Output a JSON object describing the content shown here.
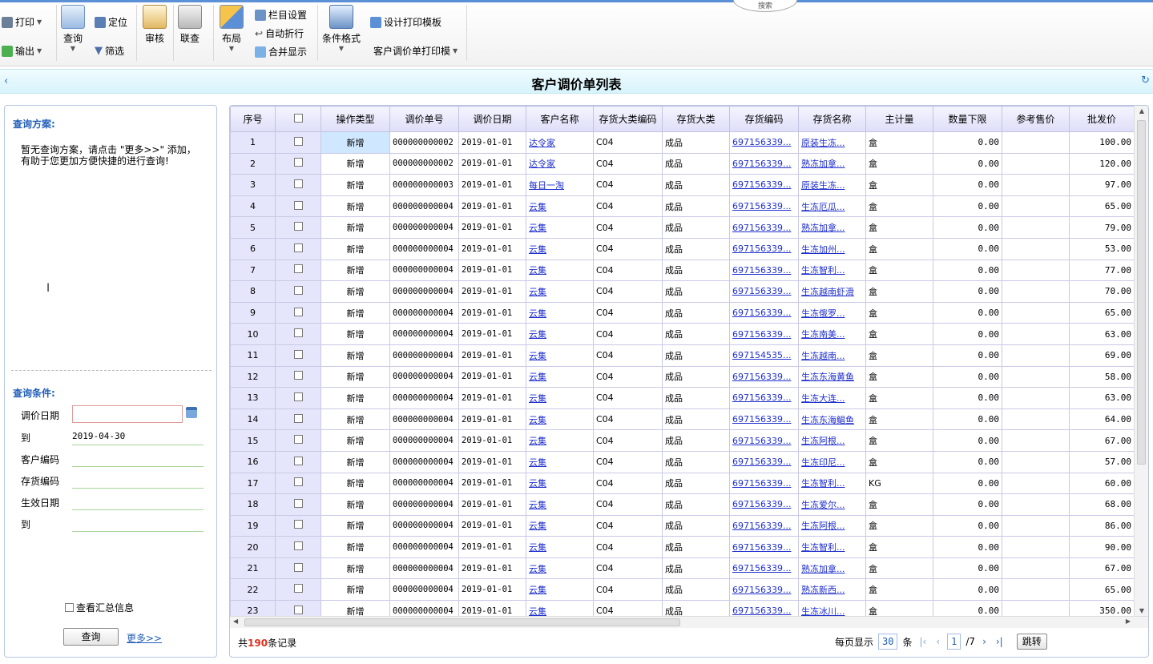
{
  "toolbar": {
    "print": "打印",
    "export": "输出",
    "query": "查询",
    "locate": "定位",
    "filter": "筛选",
    "audit": "审核",
    "linked_query": "联查",
    "layout": "布局",
    "column_settings": "栏目设置",
    "auto_wrap": "自动折行",
    "merge_display": "合并显示",
    "conditional_format": "条件格式",
    "design_print_template": "设计打印模板",
    "print_template_select": "客户调价单打印模",
    "tab_text": "搜索"
  },
  "titlebar": {
    "title": "客户调价单列表",
    "back_icon": "‹",
    "refresh_icon": "↻"
  },
  "left_panel": {
    "scheme_heading": "查询方案:",
    "no_scheme_text": "暂无查询方案，请点击 \"更多>>\" 添加，有助于您更加方便快捷的进行查询!",
    "conditions_heading": "查询条件:",
    "conditions": [
      {
        "label": "调价日期",
        "value": ""
      },
      {
        "label": "到",
        "value": "2019-04-30"
      },
      {
        "label": "客户编码",
        "value": ""
      },
      {
        "label": "存货编码",
        "value": ""
      },
      {
        "label": "生效日期",
        "value": ""
      },
      {
        "label": "到",
        "value": ""
      }
    ],
    "summary_label": "查看汇总信息",
    "query_button": "查询",
    "more_link": "更多>>"
  },
  "grid": {
    "headers": [
      "序号",
      "",
      "操作类型",
      "调价单号",
      "调价日期",
      "客户名称",
      "存货大类编码",
      "存货大类",
      "存货编码",
      "存货名称",
      "主计量",
      "数量下限",
      "参考售价",
      "批发价"
    ],
    "rows": [
      [
        "1",
        "新增",
        "000000000002",
        "2019-01-01",
        "达令家",
        "C04",
        "成品",
        "697156339...",
        "原装生冻...",
        "盒",
        "0.00",
        "",
        "100.00"
      ],
      [
        "2",
        "新增",
        "000000000002",
        "2019-01-01",
        "达令家",
        "C04",
        "成品",
        "697156339...",
        "熟冻加拿...",
        "盒",
        "0.00",
        "",
        "120.00"
      ],
      [
        "3",
        "新增",
        "000000000003",
        "2019-01-01",
        "每日一淘",
        "C04",
        "成品",
        "697156339...",
        "原装生冻...",
        "盒",
        "0.00",
        "",
        "97.00"
      ],
      [
        "4",
        "新增",
        "000000000004",
        "2019-01-01",
        "云集",
        "C04",
        "成品",
        "697156339...",
        "生冻厄瓜...",
        "盒",
        "0.00",
        "",
        "65.00"
      ],
      [
        "5",
        "新增",
        "000000000004",
        "2019-01-01",
        "云集",
        "C04",
        "成品",
        "697156339...",
        "熟冻加拿...",
        "盒",
        "0.00",
        "",
        "79.00"
      ],
      [
        "6",
        "新增",
        "000000000004",
        "2019-01-01",
        "云集",
        "C04",
        "成品",
        "697156339...",
        "生冻加州...",
        "盒",
        "0.00",
        "",
        "53.00"
      ],
      [
        "7",
        "新增",
        "000000000004",
        "2019-01-01",
        "云集",
        "C04",
        "成品",
        "697156339...",
        "生冻智利...",
        "盒",
        "0.00",
        "",
        "77.00"
      ],
      [
        "8",
        "新增",
        "000000000004",
        "2019-01-01",
        "云集",
        "C04",
        "成品",
        "697156339...",
        "生冻越南虾滑",
        "盒",
        "0.00",
        "",
        "70.00"
      ],
      [
        "9",
        "新增",
        "000000000004",
        "2019-01-01",
        "云集",
        "C04",
        "成品",
        "697156339...",
        "生冻俄罗...",
        "盒",
        "0.00",
        "",
        "65.00"
      ],
      [
        "10",
        "新增",
        "000000000004",
        "2019-01-01",
        "云集",
        "C04",
        "成品",
        "697156339...",
        "生冻南美...",
        "盒",
        "0.00",
        "",
        "63.00"
      ],
      [
        "11",
        "新增",
        "000000000004",
        "2019-01-01",
        "云集",
        "C04",
        "成品",
        "697154535...",
        "生冻越南...",
        "盒",
        "0.00",
        "",
        "69.00"
      ],
      [
        "12",
        "新增",
        "000000000004",
        "2019-01-01",
        "云集",
        "C04",
        "成品",
        "697156339...",
        "生冻东海黄鱼",
        "盒",
        "0.00",
        "",
        "58.00"
      ],
      [
        "13",
        "新增",
        "000000000004",
        "2019-01-01",
        "云集",
        "C04",
        "成品",
        "697156339...",
        "生冻大连...",
        "盒",
        "0.00",
        "",
        "63.00"
      ],
      [
        "14",
        "新增",
        "000000000004",
        "2019-01-01",
        "云集",
        "C04",
        "成品",
        "697156339...",
        "生冻东海鲳鱼",
        "盒",
        "0.00",
        "",
        "64.00"
      ],
      [
        "15",
        "新增",
        "000000000004",
        "2019-01-01",
        "云集",
        "C04",
        "成品",
        "697156339...",
        "生冻阿根...",
        "盒",
        "0.00",
        "",
        "67.00"
      ],
      [
        "16",
        "新增",
        "000000000004",
        "2019-01-01",
        "云集",
        "C04",
        "成品",
        "697156339...",
        "生冻印尼...",
        "盒",
        "0.00",
        "",
        "57.00"
      ],
      [
        "17",
        "新增",
        "000000000004",
        "2019-01-01",
        "云集",
        "C04",
        "成品",
        "697156339...",
        "生冻智利...",
        "KG",
        "0.00",
        "",
        "60.00"
      ],
      [
        "18",
        "新增",
        "000000000004",
        "2019-01-01",
        "云集",
        "C04",
        "成品",
        "697156339...",
        "生冻爱尔...",
        "盒",
        "0.00",
        "",
        "68.00"
      ],
      [
        "19",
        "新增",
        "000000000004",
        "2019-01-01",
        "云集",
        "C04",
        "成品",
        "697156339...",
        "生冻阿根...",
        "盒",
        "0.00",
        "",
        "86.00"
      ],
      [
        "20",
        "新增",
        "000000000004",
        "2019-01-01",
        "云集",
        "C04",
        "成品",
        "697156339...",
        "生冻智利...",
        "盒",
        "0.00",
        "",
        "90.00"
      ],
      [
        "21",
        "新增",
        "000000000004",
        "2019-01-01",
        "云集",
        "C04",
        "成品",
        "697156339...",
        "熟冻加拿...",
        "盒",
        "0.00",
        "",
        "67.00"
      ],
      [
        "22",
        "新增",
        "000000000004",
        "2019-01-01",
        "云集",
        "C04",
        "成品",
        "697156339...",
        "熟冻新西...",
        "盒",
        "0.00",
        "",
        "65.00"
      ],
      [
        "23",
        "新增",
        "000000000004",
        "2019-01-01",
        "云集",
        "C04",
        "成品",
        "697156339...",
        "生冻冰川...",
        "盒",
        "0.00",
        "",
        "350.00"
      ]
    ]
  },
  "footer": {
    "record_prefix": "共",
    "record_count": "190",
    "record_suffix": "条记录",
    "per_page_label": "每页显示",
    "per_page_value": "30",
    "per_page_unit": "条",
    "current_page": "1",
    "total_pages": "/7",
    "jump_button": "跳转"
  },
  "colors": {
    "accent": "#1f5db8",
    "link": "#1f2fcc",
    "record_count": "#e0301e",
    "titlebar_bg": "#d7f3fb"
  }
}
